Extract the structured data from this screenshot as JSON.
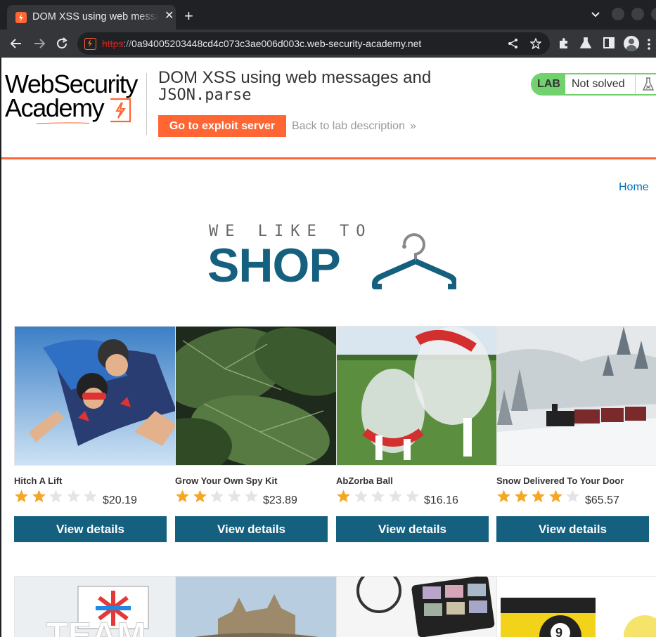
{
  "browser": {
    "tab_title": "DOM XSS using web messages and JSON.parse",
    "tab_close_icon": "close-icon",
    "new_tab_icon": "plus-icon",
    "url_scheme": "https",
    "url_separator": "://",
    "url_host": "0a94005203448cd4c073c3ae006d003c.web-security-academy.net",
    "colors": {
      "tabstrip": "#202124",
      "toolbar": "#35363a",
      "text": "#e8eaed",
      "insecure_scheme": "#c5221f"
    }
  },
  "header": {
    "logo_line1": "WebSecurity",
    "logo_line2": "Academy",
    "lab_title": "DOM XSS using web messages and",
    "lab_title_code": "JSON.parse",
    "exploit_button": "Go to exploit server",
    "back_link": "Back to lab description",
    "back_chevron": "»",
    "lab_badge": "LAB",
    "lab_status": "Not solved",
    "colors": {
      "accent": "#ff6633",
      "status_green": "#70d16d"
    }
  },
  "nav": {
    "home_link": "Home"
  },
  "banner": {
    "tagline": "WE LIKE TO",
    "word": "SHOP",
    "color": "#15607f"
  },
  "products": [
    {
      "name": "Hitch A Lift",
      "rating": 2,
      "max_rating": 5,
      "price": "$20.19",
      "button": "View details"
    },
    {
      "name": "Grow Your Own Spy Kit",
      "rating": 2,
      "max_rating": 5,
      "price": "$23.89",
      "button": "View details"
    },
    {
      "name": "AbZorba Ball",
      "rating": 1,
      "max_rating": 5,
      "price": "$16.16",
      "button": "View details"
    },
    {
      "name": "Snow Delivered To Your Door",
      "rating": 4,
      "max_rating": 5,
      "price": "$65.57",
      "button": "View details"
    }
  ],
  "row2_images": [
    "TEAM",
    "",
    "",
    "9"
  ]
}
